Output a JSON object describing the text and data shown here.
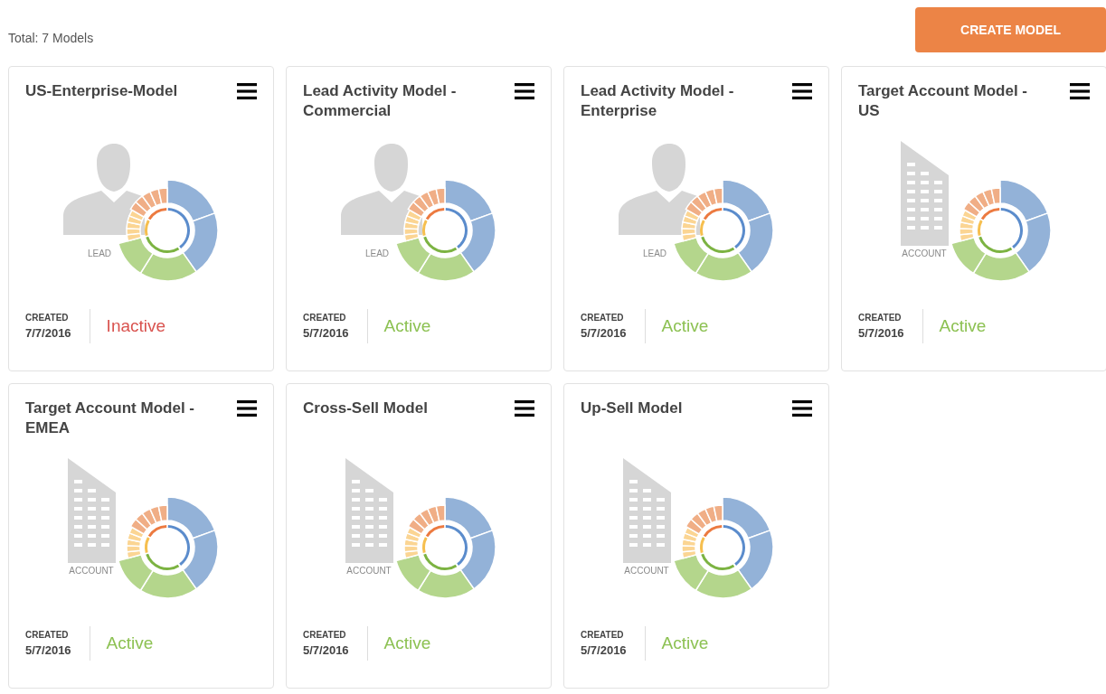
{
  "summary": "Total: 7 Models",
  "create_button": "CREATE MODEL",
  "models": [
    {
      "title": "US-Enterprise-Model",
      "illustration": {
        "kind": "lead",
        "label": "LEAD"
      },
      "created_label": "CREATED",
      "created": "7/7/2016",
      "status": "Inactive",
      "active": false
    },
    {
      "title": "Lead Activity Model - Commercial",
      "illustration": {
        "kind": "lead",
        "label": "LEAD"
      },
      "created_label": "CREATED",
      "created": "5/7/2016",
      "status": "Active",
      "active": true
    },
    {
      "title": "Lead Activity Model - Enterprise",
      "illustration": {
        "kind": "lead",
        "label": "LEAD"
      },
      "created_label": "CREATED",
      "created": "5/7/2016",
      "status": "Active",
      "active": true
    },
    {
      "title": "Target Account Model - US",
      "illustration": {
        "kind": "account",
        "label": "ACCOUNT"
      },
      "created_label": "CREATED",
      "created": "5/7/2016",
      "status": "Active",
      "active": true
    },
    {
      "title": "Target Account Model - EMEA",
      "illustration": {
        "kind": "account",
        "label": "ACCOUNT"
      },
      "created_label": "CREATED",
      "created": "5/7/2016",
      "status": "Active",
      "active": true
    },
    {
      "title": "Cross-Sell Model",
      "illustration": {
        "kind": "account",
        "label": "ACCOUNT"
      },
      "created_label": "CREATED",
      "created": "5/7/2016",
      "status": "Active",
      "active": true
    },
    {
      "title": "Up-Sell Model",
      "illustration": {
        "kind": "account",
        "label": "ACCOUNT"
      },
      "created_label": "CREATED",
      "created": "5/7/2016",
      "status": "Active",
      "active": true
    }
  ]
}
